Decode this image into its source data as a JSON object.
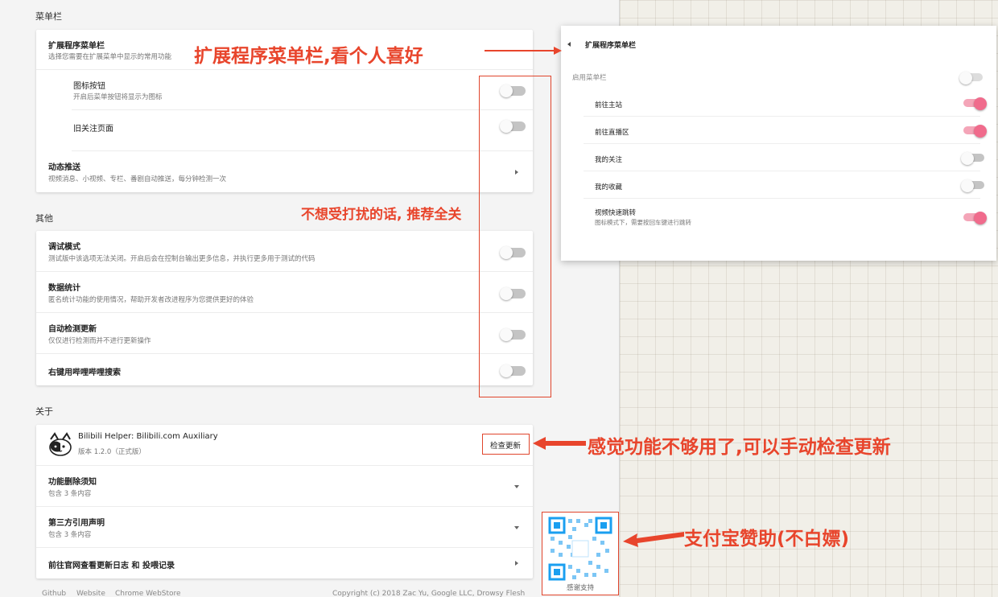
{
  "settings": {
    "menu_section": {
      "title": "菜单栏",
      "card": {
        "rows": [
          {
            "title": "扩展程序菜单栏",
            "desc": "选择您需要在扩展菜单中显示的常用功能"
          },
          {
            "title": "图标按钮",
            "desc": "开启后菜单按钮将显示为图标"
          },
          {
            "title": "旧关注页面",
            "desc": ""
          },
          {
            "title": "动态推送",
            "desc": "视频消息、小视频、专栏、番剧自动推送，每分钟检测一次"
          }
        ]
      }
    },
    "other_section": {
      "title": "其他",
      "rows": [
        {
          "title": "调试模式",
          "desc": "测试版中该选项无法关闭。开启后会在控制台输出更多信息，并执行更多用于测试的代码"
        },
        {
          "title": "数据统计",
          "desc": "匿名统计功能的使用情况，帮助开发者改进程序为您提供更好的体验"
        },
        {
          "title": "自动检测更新",
          "desc": "仅仅进行检测而并不进行更新操作"
        },
        {
          "title": "右键用哔哩哔哩搜索",
          "desc": ""
        }
      ]
    },
    "about_section": {
      "title": "关于",
      "app_name": "Bilibili Helper: Bilibili.com Auxiliary",
      "version": "版本 1.2.0（正式版）",
      "check_update_label": "检查更新",
      "rows": [
        {
          "title": "功能删除须知",
          "desc": "包含 3 条内容"
        },
        {
          "title": "第三方引用声明",
          "desc": "包含 3 条内容"
        },
        {
          "title": "前往官网查看更新日志 和 投喂记录",
          "desc": ""
        }
      ]
    },
    "footer": {
      "links": [
        "Github",
        "Website",
        "Chrome WebStore"
      ],
      "copyright": "Copyright (c) 2018 Zac Yu, Google LLC, Drowsy Flesh"
    }
  },
  "popup": {
    "title": "扩展程序菜单栏",
    "enable_label": "启用菜单栏",
    "items": [
      {
        "label": "前往主站",
        "desc": "",
        "on": true
      },
      {
        "label": "前往直播区",
        "desc": "",
        "on": true
      },
      {
        "label": "我的关注",
        "desc": "",
        "on": false
      },
      {
        "label": "我的收藏",
        "desc": "",
        "on": false
      },
      {
        "label": "视频快速跳转",
        "desc": "图标模式下，需要按回车键进行跳转",
        "on": true
      }
    ]
  },
  "annotations": {
    "menu_note": "扩展程序菜单栏,看个人喜好",
    "disturb_note": "不想受打扰的话, 推荐全关",
    "update_note": "感觉功能不够用了,可以手动检查更新",
    "donate_note": "支付宝赞助(不白嫖)",
    "qr_caption": "感谢支持"
  },
  "colors": {
    "annotation_red": "#e8452c",
    "toggle_on": "#f06b8c",
    "toggle_off": "#c4c4c4"
  }
}
